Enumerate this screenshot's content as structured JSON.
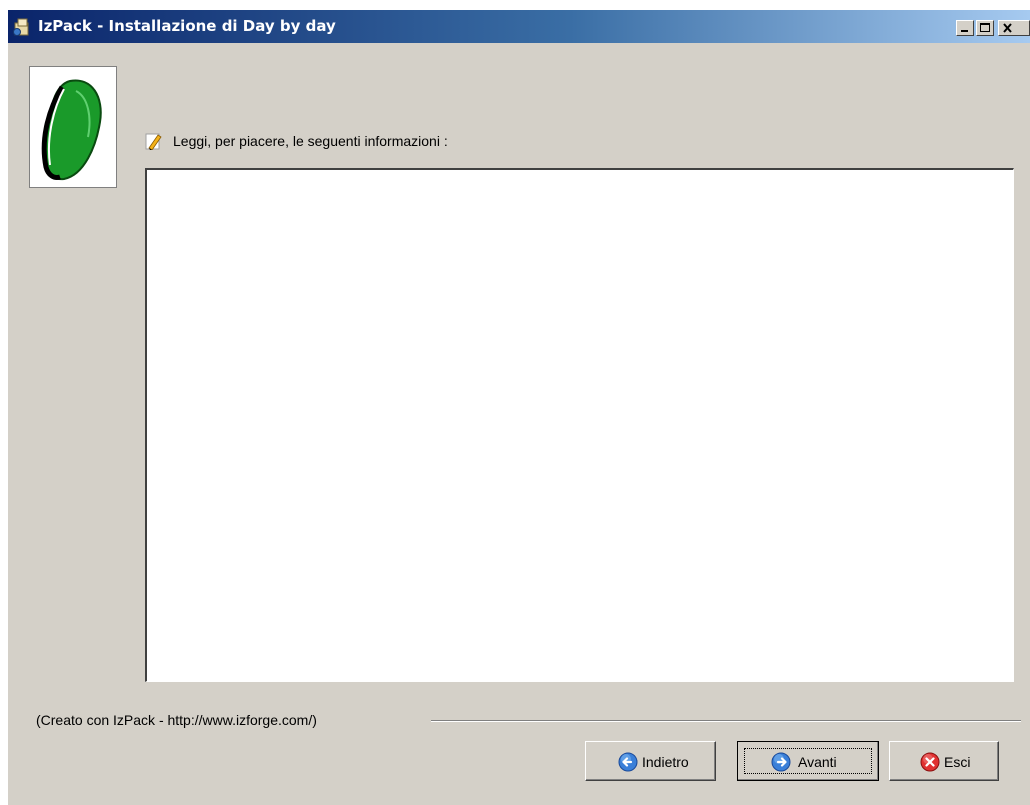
{
  "window": {
    "title": "IzPack - Installazione di Day by day",
    "controls": {
      "minimize_icon": "minimize-icon",
      "maximize_icon": "maximize-icon",
      "close_icon": "close-icon"
    },
    "colors": {
      "titlebar_start": "#0a246a",
      "titlebar_end": "#a6caf0",
      "background": "#d4d0c8"
    }
  },
  "sidebar": {
    "logo_icon": "day-by-day-logo"
  },
  "main": {
    "info_icon": "pencil-icon",
    "info_label": "Leggi, per piacere, le seguenti informazioni :",
    "info_text": ""
  },
  "footer": {
    "credit": "(Creato con IzPack - http://www.izforge.com/)",
    "buttons": {
      "back_label": "Indietro",
      "next_label": "Avanti",
      "quit_label": "Esci",
      "back_icon": "arrow-left-icon",
      "next_icon": "arrow-right-icon",
      "quit_icon": "close-circle-icon"
    }
  }
}
